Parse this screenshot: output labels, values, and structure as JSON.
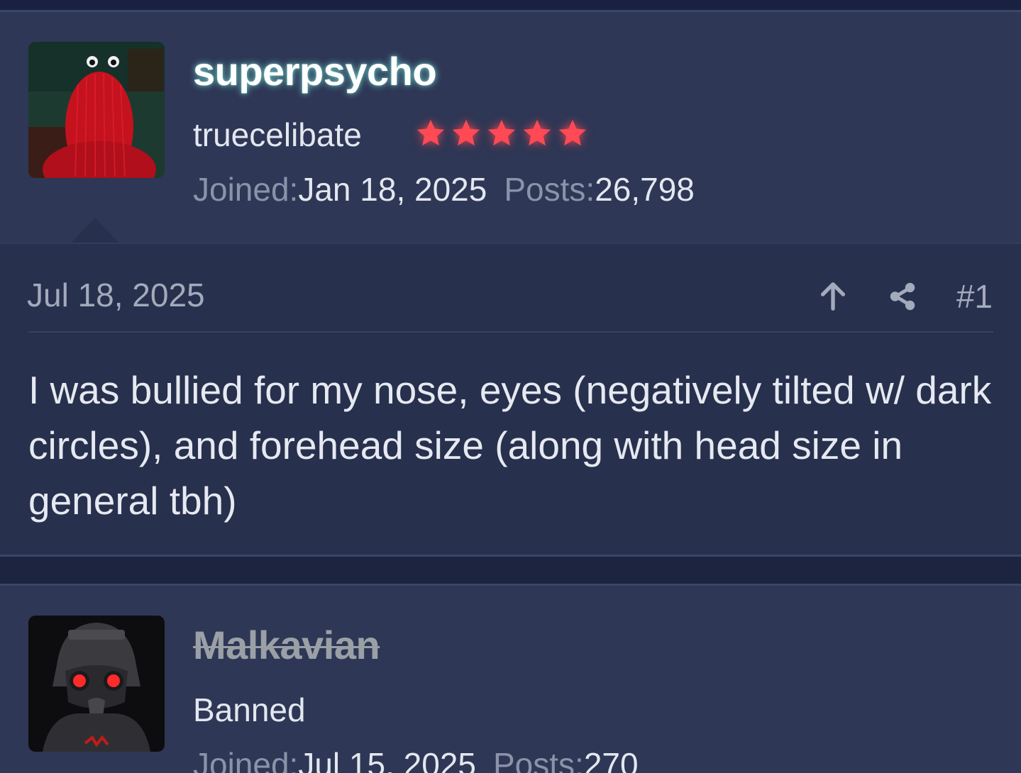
{
  "posts": [
    {
      "username": "superpsycho",
      "user_title": "truecelibate",
      "stars": 5,
      "joined_label": "Joined:",
      "joined_value": "Jan 18, 2025",
      "posts_label": "Posts:",
      "posts_value": "26,798",
      "date": "Jul 18, 2025",
      "post_number": "#1",
      "body": "I was bullied for my nose, eyes (negatively tilted w/ dark circles), and forehead size (along with head size in general tbh)"
    },
    {
      "username": "Malkavian",
      "user_title": "Banned",
      "joined_label": "Joined:",
      "joined_value": "Jul 15, 2025",
      "posts_label": "Posts:",
      "posts_value": "270"
    }
  ],
  "icons": {
    "upvote": "arrow-up-icon",
    "share": "share-icon",
    "star": "star-icon"
  },
  "colors": {
    "star": "#ff4a55",
    "username_glow": "#78dcd2",
    "banned_username": "#9aa0a6"
  }
}
